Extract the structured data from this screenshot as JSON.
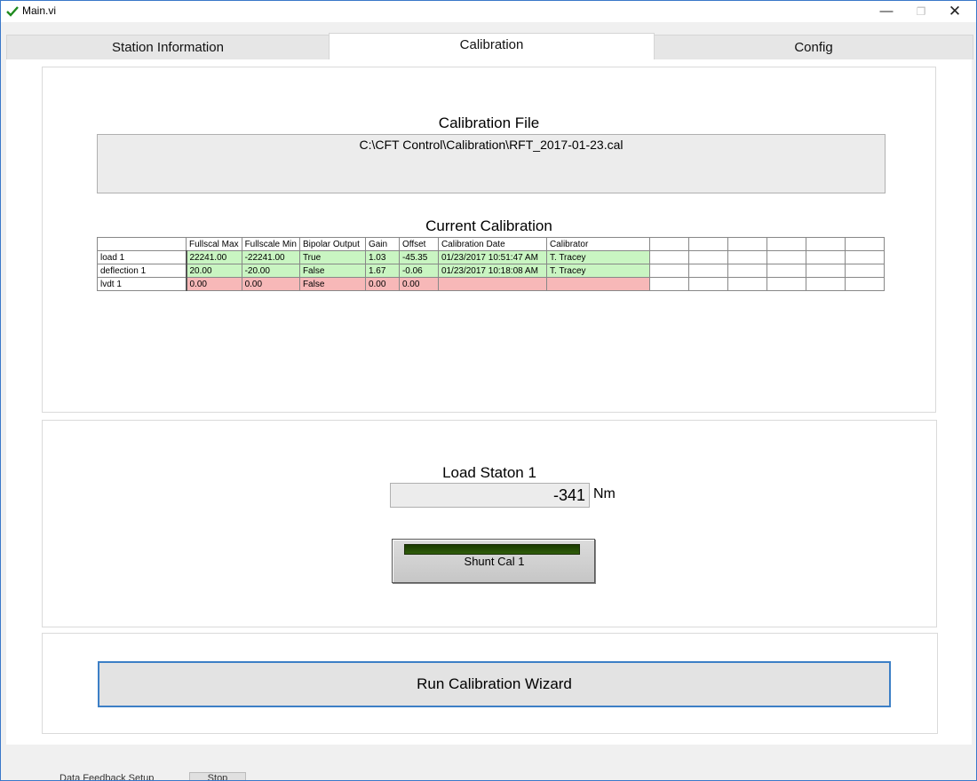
{
  "window": {
    "title": "Main.vi",
    "min_glyph": "—",
    "max_glyph": "❐",
    "close_glyph": "✕"
  },
  "tabs": [
    {
      "label": "Station Information",
      "active": false
    },
    {
      "label": "Calibration",
      "active": true
    },
    {
      "label": "Config",
      "active": false
    }
  ],
  "calibration_file": {
    "title": "Calibration File",
    "path": "C:\\CFT Control\\Calibration\\RFT_2017-01-23.cal"
  },
  "current_calibration": {
    "title": "Current Calibration",
    "columns": [
      "",
      "Fullscal Max",
      "Fullscale Min",
      "Bipolar Output",
      "Gain",
      "Offset",
      "Calibration Date",
      "Calibrator"
    ],
    "rows": [
      {
        "name": "load 1",
        "status": "green",
        "cells": [
          "22241.00",
          "-22241.00",
          "True",
          "1.03",
          "-45.35",
          "01/23/2017 10:51:47 AM",
          "T. Tracey"
        ]
      },
      {
        "name": "deflection 1",
        "status": "green",
        "cells": [
          "20.00",
          "-20.00",
          "False",
          "1.67",
          "-0.06",
          "01/23/2017 10:18:08 AM",
          "T. Tracey"
        ]
      },
      {
        "name": "lvdt 1",
        "status": "red",
        "cells": [
          "0.00",
          "0.00",
          "False",
          "0.00",
          "0.00",
          "",
          ""
        ]
      }
    ]
  },
  "load_station": {
    "title": "Load Staton 1",
    "value": "-341",
    "unit": "Nm"
  },
  "shunt_button": {
    "label": "Shunt Cal 1",
    "led_color": "#2f5d0a"
  },
  "wizard_button": {
    "label": "Run Calibration Wizard"
  },
  "status": {
    "label": "Data Feedback Setup",
    "field_value": "Stop"
  },
  "colors": {
    "accent": "#3c7fc6",
    "ok_row": "#c9f5c2",
    "bad_row": "#f7b8b8"
  }
}
